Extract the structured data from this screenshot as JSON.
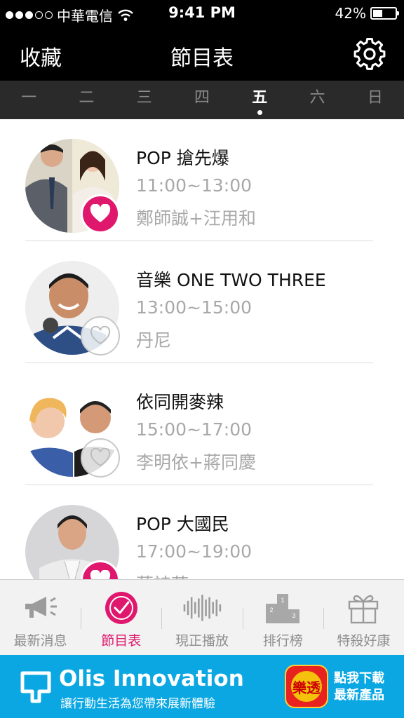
{
  "status": {
    "carrier": "中華電信",
    "time": "9:41 PM",
    "battery": "42%",
    "battery_level": 0.42
  },
  "nav": {
    "left_label": "收藏",
    "title": "節目表",
    "settings_icon": "gear-icon"
  },
  "days": [
    "一",
    "二",
    "三",
    "四",
    "五",
    "六",
    "日"
  ],
  "active_day": 4,
  "programs": [
    {
      "title": "POP 搶先爆",
      "time": "11:00~13:00",
      "hosts": "鄭師誠+汪用和",
      "favorite": true
    },
    {
      "title": "音樂 ONE TWO THREE",
      "time": "13:00~15:00",
      "hosts": "丹尼",
      "favorite": false
    },
    {
      "title": "依同開麥辣",
      "time": "15:00~17:00",
      "hosts": "李明依+蔣同慶",
      "favorite": false
    },
    {
      "title": "POP 大國民",
      "time": "17:00~19:00",
      "hosts": "蔡詩萍",
      "favorite": true
    }
  ],
  "tabs": [
    {
      "label": "最新消息",
      "icon": "megaphone-icon"
    },
    {
      "label": "節目表",
      "icon": "clock-icon",
      "active": true
    },
    {
      "label": "現正播放",
      "icon": "waveform-icon"
    },
    {
      "label": "排行榜",
      "icon": "podium-icon"
    },
    {
      "label": "特殺好康",
      "icon": "gift-icon"
    }
  ],
  "ad": {
    "brand": "Olis Innovation",
    "slogan": "讓行動生活為您帶來展新體驗",
    "app_icon_text": "樂透",
    "cta_line1": "點我下載",
    "cta_line2": "最新產品"
  },
  "colors": {
    "accent": "#e0186d",
    "ad_background": "#0aa7e2",
    "header": "#000000",
    "day_bar": "#2a2a2a"
  }
}
